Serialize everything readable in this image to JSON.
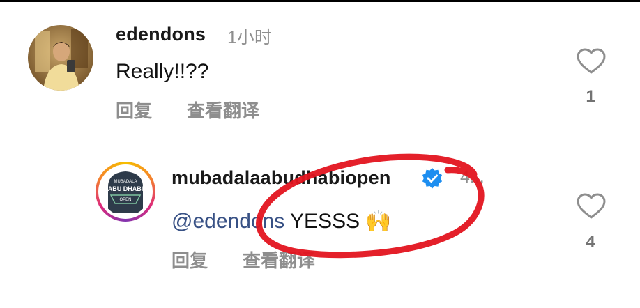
{
  "comments": [
    {
      "username": "edendons",
      "time": "1小时",
      "text": "Really!!??",
      "reply_label": "回复",
      "translate_label": "查看翻译",
      "likes": "1"
    },
    {
      "username": "mubadalaabudhabiopen",
      "time": "4...",
      "mention": "@edendons",
      "text": " YESSS 🙌",
      "reply_label": "回复",
      "translate_label": "查看翻译",
      "likes": "4",
      "verified": true,
      "avatar_logo": {
        "line1": "MUBADALA",
        "line2": "ABU DHABI",
        "line3": "OPEN"
      }
    }
  ],
  "colors": {
    "annotation_circle": "#e3141f",
    "verified_badge": "#1d8ef0",
    "mention": "#385185",
    "secondary_text": "#8e8e8e"
  },
  "icons": [
    "heart-icon",
    "verified-badge-icon",
    "threads-mention-icon"
  ]
}
